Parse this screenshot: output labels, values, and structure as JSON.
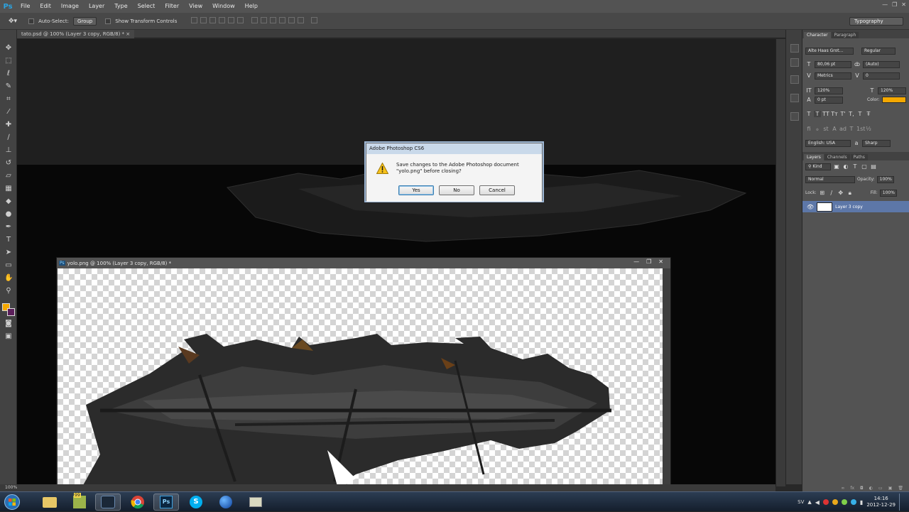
{
  "app": {
    "logo": "Ps",
    "name": "Adobe Photoshop CS6"
  },
  "menu": [
    "File",
    "Edit",
    "Image",
    "Layer",
    "Type",
    "Select",
    "Filter",
    "View",
    "Window",
    "Help"
  ],
  "window_controls": [
    "—",
    "❐",
    "✕"
  ],
  "options_bar": {
    "auto_select_label": "Auto-Select:",
    "auto_select_value": "Group",
    "transform_label": "Show Transform Controls",
    "workspace": "Typography"
  },
  "bg_tab": {
    "title": "tato.psd @ 100% (Layer 3 copy, RGB/8) *",
    "close": "×"
  },
  "doc_window": {
    "title": "yolo.png @ 100% (Layer 3 copy, RGB/8) *",
    "controls": [
      "—",
      "❐",
      "✕"
    ]
  },
  "dialog": {
    "title": "Adobe Photoshop CS6",
    "message_line1": "Save changes to the Adobe Photoshop document",
    "message_line2": "\"yolo.png\" before closing?",
    "yes": "Yes",
    "no": "No",
    "cancel": "Cancel"
  },
  "status": {
    "zoom": "100%"
  },
  "character_panel": {
    "tabs": [
      "Character",
      "Paragraph"
    ],
    "font_family": "Alte Haas Grot...",
    "font_style": "Regular",
    "font_size": "80,06 pt",
    "leading": "(Auto)",
    "kerning": "Metrics",
    "tracking": "0",
    "vscale": "120%",
    "hscale": "120%",
    "baseline": "0 pt",
    "color_label": "Color:",
    "color": "#f5a800",
    "style_buttons": [
      "T",
      "T",
      "TT",
      "Tт",
      "T'",
      "T,",
      "T",
      "Ŧ"
    ],
    "ot_buttons": [
      "ﬁ",
      "ℴ",
      "st",
      "A",
      "ad",
      "T",
      "1st",
      "½"
    ],
    "language": "English: USA",
    "antialias": "Sharp"
  },
  "layers_panel": {
    "tabs": [
      "Layers",
      "Channels",
      "Paths"
    ],
    "filter": "Kind",
    "blend_mode": "Normal",
    "opacity_label": "Opacity:",
    "opacity": "100%",
    "lock_label": "Lock:",
    "fill_label": "Fill:",
    "fill": "100%",
    "layers": [
      {
        "name": "Layer 3 copy",
        "visible": true
      }
    ]
  },
  "taskbar": {
    "badge": "99",
    "lang": "SV",
    "time": "14:16",
    "date": "2012-12-29"
  }
}
